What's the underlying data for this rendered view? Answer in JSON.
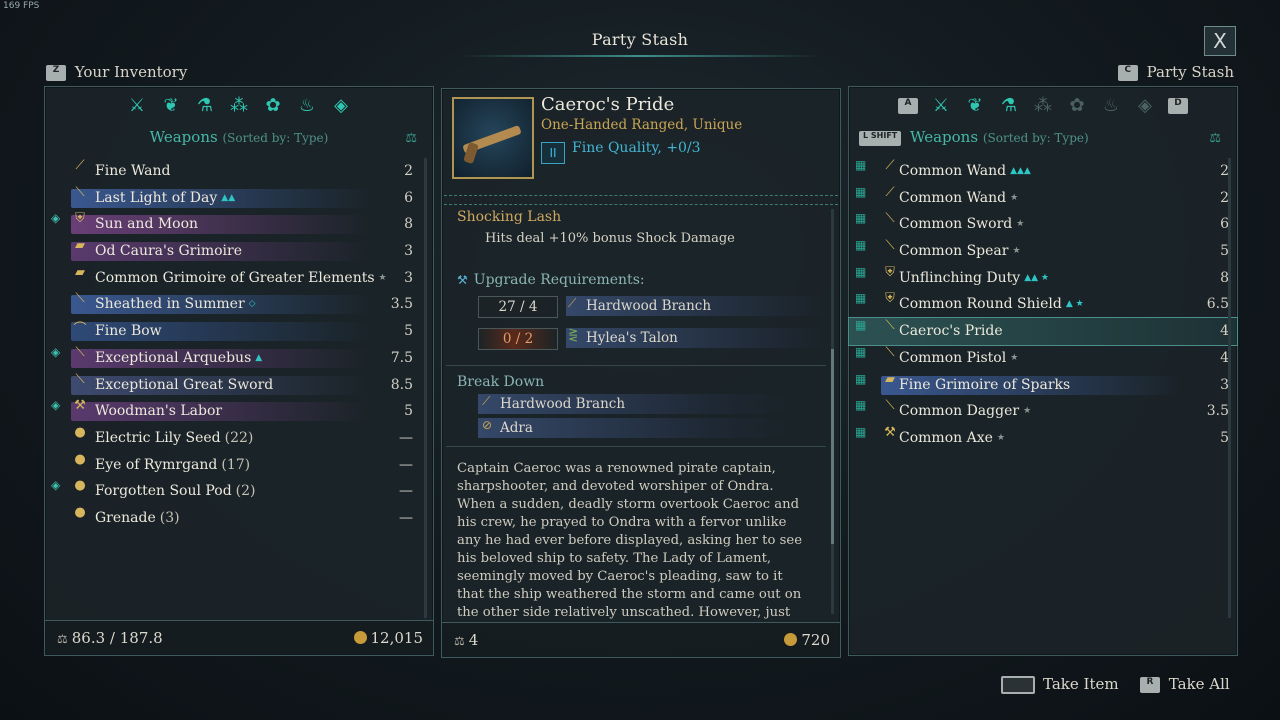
{
  "fps": "169 FPS",
  "title": "Party Stash",
  "close_label": "X",
  "left_label": {
    "key": "Z",
    "text": "Your Inventory"
  },
  "right_label": {
    "key": "C",
    "text": "Party Stash"
  },
  "left_panel": {
    "category": "Weapons",
    "sorted": "(Sorted by: Type)",
    "items": [
      {
        "name": "Fine Wand",
        "count": "",
        "value": "2",
        "icon": "wand-icon",
        "glyph": "⟋",
        "bar": "",
        "mark": false,
        "tag": ""
      },
      {
        "name": "Last Light of Day",
        "count": "",
        "value": "6",
        "icon": "sword-icon",
        "glyph": "⟍",
        "bar": "#3a5890",
        "mark": false,
        "tag": "▲▲"
      },
      {
        "name": "Sun and Moon",
        "count": "",
        "value": "8",
        "icon": "shield-icon",
        "glyph": "⛨",
        "bar": "#6a3f78",
        "mark": true,
        "tag": ""
      },
      {
        "name": "Od Caura's Grimoire",
        "count": "",
        "value": "3",
        "icon": "grimoire-icon",
        "glyph": "▰",
        "bar": "#5b3a6e",
        "mark": false,
        "tag": ""
      },
      {
        "name": "Common Grimoire of Greater Elements",
        "count": "",
        "value": "3",
        "icon": "grimoire-icon",
        "glyph": "▰",
        "bar": "",
        "mark": false,
        "tag": "★"
      },
      {
        "name": "Sheathed in Summer",
        "count": "",
        "value": "3.5",
        "icon": "dagger-icon",
        "glyph": "⟍",
        "bar": "#3a5890",
        "mark": false,
        "tag": "◇"
      },
      {
        "name": "Fine Bow",
        "count": "",
        "value": "5",
        "icon": "bow-icon",
        "glyph": "⌒",
        "bar": "#2f4a78",
        "mark": false,
        "tag": ""
      },
      {
        "name": "Exceptional Arquebus",
        "count": "",
        "value": "7.5",
        "icon": "arquebus-icon",
        "glyph": "⟍",
        "bar": "#5b3a6e",
        "mark": true,
        "tag": "▲"
      },
      {
        "name": "Exceptional Great Sword",
        "count": "",
        "value": "8.5",
        "icon": "greatsword-icon",
        "glyph": "⟍",
        "bar": "#3e4a70",
        "mark": false,
        "tag": ""
      },
      {
        "name": "Woodman's Labor",
        "count": "",
        "value": "5",
        "icon": "axe-icon",
        "glyph": "⚒",
        "bar": "#5b3a6e",
        "mark": true,
        "tag": ""
      },
      {
        "name": "Electric Lily Seed",
        "count": "(22)",
        "value": "—",
        "icon": "seed-icon",
        "glyph": "●",
        "bar": "",
        "mark": false,
        "tag": ""
      },
      {
        "name": "Eye of Rymrgand",
        "count": "(17)",
        "value": "—",
        "icon": "seed-icon",
        "glyph": "●",
        "bar": "",
        "mark": false,
        "tag": ""
      },
      {
        "name": "Forgotten Soul Pod",
        "count": "(2)",
        "value": "—",
        "icon": "seed-icon",
        "glyph": "●",
        "bar": "",
        "mark": true,
        "tag": ""
      },
      {
        "name": "Grenade",
        "count": "(3)",
        "value": "—",
        "icon": "grenade-icon",
        "glyph": "●",
        "bar": "",
        "mark": false,
        "tag": ""
      }
    ],
    "weight": "86.3 / 187.8",
    "money": "12,015"
  },
  "detail": {
    "name": "Caeroc's Pride",
    "type": "One-Handed Ranged, Unique",
    "quality_tier": "II",
    "quality": "Fine Quality, +0/3",
    "enchant_name": "Shocking Lash",
    "enchant_desc": "Hits deal +10% bonus Shock Damage",
    "upgrade_header": "Upgrade Requirements:",
    "requirements": [
      {
        "have": "27 / 4",
        "name": "Hardwood Branch",
        "ok": true
      },
      {
        "have": "0 / 2",
        "name": "Hylea's Talon",
        "ok": false
      }
    ],
    "breakdown_header": "Break Down",
    "breakdown": [
      "Hardwood Branch",
      "Adra"
    ],
    "description": "Captain Caeroc was a renowned pirate captain, sharpshooter, and devoted worshiper of Ondra. When a sudden, deadly storm overtook Caeroc and his crew, he prayed to Ondra with a fervor unlike any he had ever before displayed, asking her to see his beloved ship to safety. The Lady of Lament, seemingly moved by Caeroc's pleading, saw to it that the ship weathered the storm and came out on the other side relatively unscathed. However, just before Caeroc and his crew",
    "weight": "4",
    "value": "720"
  },
  "right_panel": {
    "key_left": "A",
    "key_right": "D",
    "shift_key": "L SHIFT",
    "category": "Weapons",
    "sorted": "(Sorted by: Type)",
    "items": [
      {
        "name": "Common Wand",
        "value": "2",
        "icon": "wand-icon",
        "glyph": "⟋",
        "bar": "",
        "tag": "▲▲▲",
        "sel": false
      },
      {
        "name": "Common Wand",
        "value": "2",
        "icon": "wand-icon",
        "glyph": "⟋",
        "bar": "",
        "tag": "★",
        "sel": false
      },
      {
        "name": "Common Sword",
        "value": "6",
        "icon": "sword-icon",
        "glyph": "⟍",
        "bar": "",
        "tag": "★",
        "sel": false
      },
      {
        "name": "Common Spear",
        "value": "5",
        "icon": "spear-icon",
        "glyph": "⟍",
        "bar": "",
        "tag": "★",
        "sel": false
      },
      {
        "name": "Unflinching Duty",
        "value": "8",
        "icon": "shield-icon",
        "glyph": "⛨",
        "bar": "",
        "tag": "▲▲ ★",
        "sel": false
      },
      {
        "name": "Common Round Shield",
        "value": "6.5",
        "icon": "round-shield-icon",
        "glyph": "⛨",
        "bar": "",
        "tag": "▲ ★",
        "sel": false
      },
      {
        "name": "Caeroc's Pride",
        "value": "4",
        "icon": "pistol-icon",
        "glyph": "⟍",
        "bar": "",
        "tag": "",
        "sel": true
      },
      {
        "name": "Common Pistol",
        "value": "4",
        "icon": "pistol-icon",
        "glyph": "⟍",
        "bar": "",
        "tag": "★",
        "sel": false
      },
      {
        "name": "Fine Grimoire of Sparks",
        "value": "3",
        "icon": "grimoire-icon",
        "glyph": "▰",
        "bar": "#3a5890",
        "tag": "",
        "sel": false
      },
      {
        "name": "Common Dagger",
        "value": "3.5",
        "icon": "dagger-icon",
        "glyph": "⟍",
        "bar": "",
        "tag": "★",
        "sel": false
      },
      {
        "name": "Common Axe",
        "value": "5",
        "icon": "axe-icon",
        "glyph": "⚒",
        "bar": "",
        "tag": "★",
        "sel": false
      }
    ]
  },
  "actions": {
    "take_item": "Take Item",
    "take_all_key": "R",
    "take_all": "Take All"
  }
}
